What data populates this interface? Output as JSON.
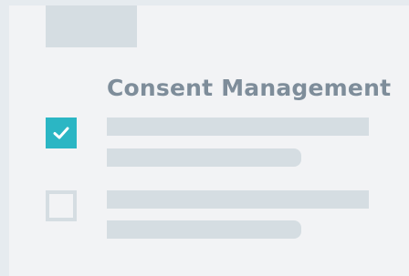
{
  "header": {
    "title": "Consent Management"
  },
  "consent_items": [
    {
      "checked": true,
      "icon": "check-icon"
    },
    {
      "checked": false,
      "icon": ""
    }
  ],
  "colors": {
    "background": "#e6ebef",
    "panel": "#f2f3f5",
    "placeholder": "#d5dde2",
    "title": "#7e8d9a",
    "accent": "#2bb6c4"
  }
}
